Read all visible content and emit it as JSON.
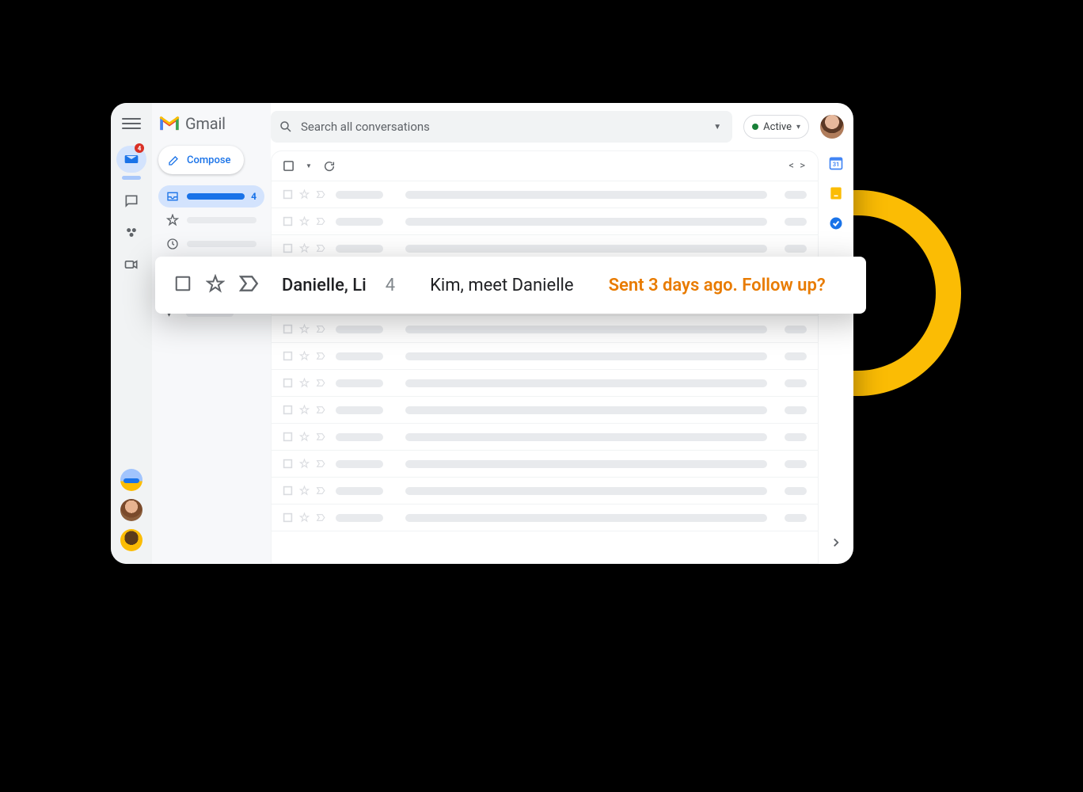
{
  "app": {
    "name": "Gmail"
  },
  "sidebar": {
    "compose": "Compose",
    "inbox_count": "4"
  },
  "rail": {
    "mail_badge": "4"
  },
  "search": {
    "placeholder": "Search all conversations"
  },
  "status": {
    "label": "Active"
  },
  "highlight": {
    "senders": "Danielle, Li",
    "count": "4",
    "subject": "Kim, meet Danielle",
    "nudge": "Sent 3 days ago. Follow up?"
  }
}
